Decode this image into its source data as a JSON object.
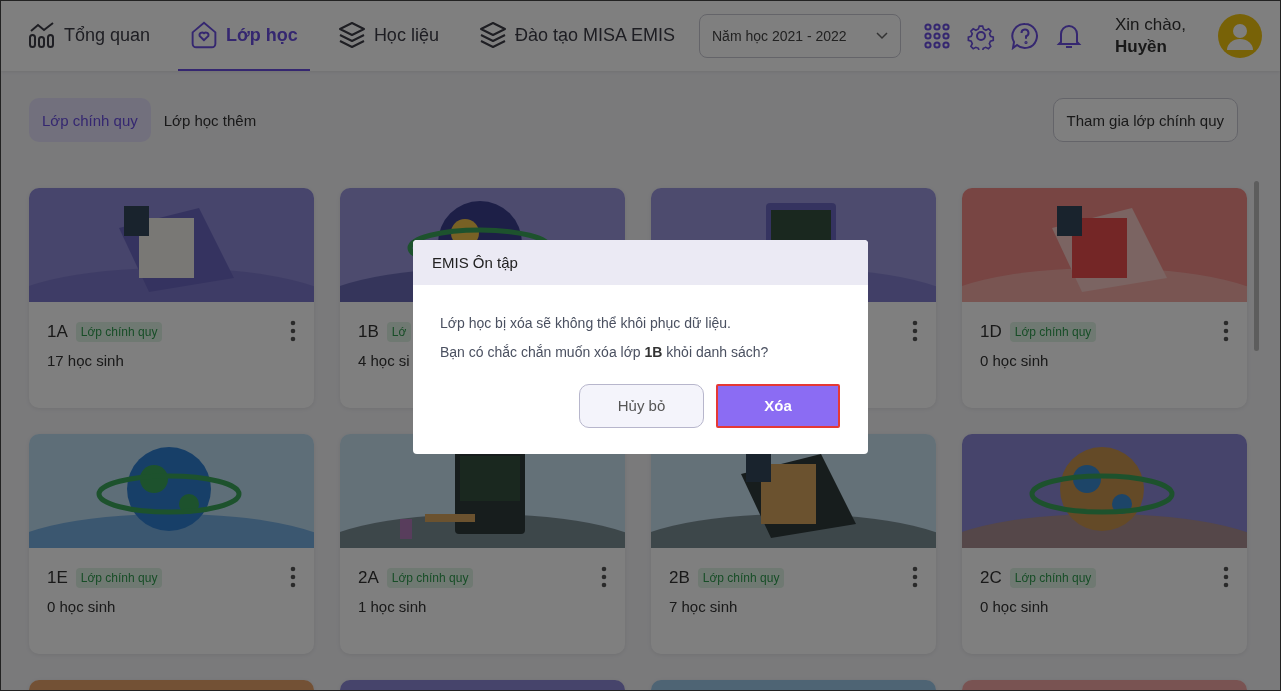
{
  "nav": [
    {
      "label": "Tổng quan",
      "selected": false
    },
    {
      "label": "Lớp học",
      "selected": true
    },
    {
      "label": "Học liệu",
      "selected": false
    },
    {
      "label": "Đào tạo MISA EMIS",
      "selected": false
    }
  ],
  "year_select": {
    "value": "Năm học 2021 - 2022"
  },
  "greeting": {
    "line1": "Xin chào,",
    "name": "Huyền"
  },
  "filter_tabs": [
    {
      "label": "Lớp chính quy",
      "selected": true
    },
    {
      "label": "Lớp học thêm",
      "selected": false
    }
  ],
  "join_button": "Tham gia lớp chính quy",
  "cards": [
    {
      "name": "1A",
      "tag": "Lớp chính quy",
      "count": "17 học sinh"
    },
    {
      "name": "1B",
      "tag": "Lớ",
      "count": "4 học si",
      "kind": "covered"
    },
    {
      "kind": "partial"
    },
    {
      "name": "1D",
      "tag": "Lớp chính quy",
      "count": "0 học sinh"
    },
    {
      "name": "1E",
      "tag": "Lớp chính quy",
      "count": "0 học sinh"
    },
    {
      "name": "2A",
      "tag": "Lớp chính quy",
      "count": "1 học sinh"
    },
    {
      "name": "2B",
      "tag": "Lớp chính quy",
      "count": "7 học sinh"
    },
    {
      "name": "2C",
      "tag": "Lớp chính quy",
      "count": "0 học sinh"
    },
    {
      "kind": "picture"
    },
    {
      "kind": "picture"
    },
    {
      "kind": "picture"
    },
    {
      "kind": "picture"
    }
  ],
  "dialog": {
    "title": "EMIS Ôn tập",
    "lines": [
      "Lớp học bị xóa sẽ không thể khôi phục dữ liệu.",
      "Bạn có chắc chắn muốn xóa lớp **1B** khỏi danh sách?"
    ],
    "buttons": [
      {
        "label": "Hủy bỏ",
        "kind": "secondary"
      },
      {
        "label": "Xóa",
        "kind": "primary"
      }
    ]
  }
}
